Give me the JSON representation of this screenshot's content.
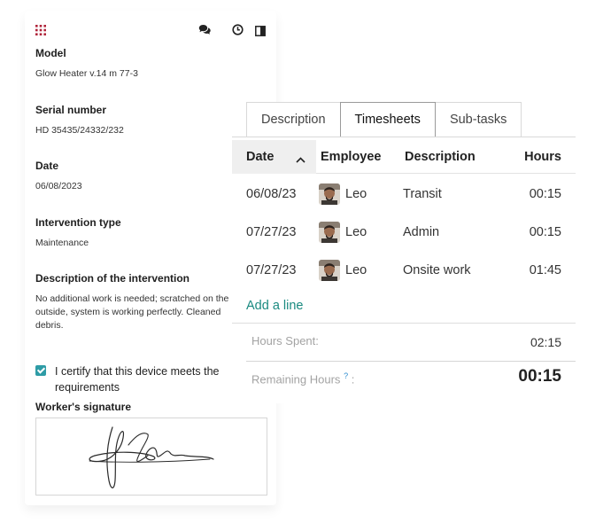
{
  "form": {
    "model_label": "Model",
    "model_value": "Glow Heater v.14 m 77-3",
    "serial_label": "Serial number",
    "serial_value": "HD 35435/24332/232",
    "date_label": "Date",
    "date_value": "06/08/2023",
    "type_label": "Intervention type",
    "type_value": "Maintenance",
    "desc_label": "Description of the intervention",
    "desc_line1": "No additional work is needed; scratched on the",
    "desc_line2": "outside, system is working perfectly. Cleaned",
    "desc_line3": "debris.",
    "certify_line1": "I certify that this device meets the",
    "certify_line2": "requirements",
    "certify_checked": true,
    "signature_label": "Worker's signature"
  },
  "icons": {
    "apps": "apps-grid-icon",
    "chat": "chat-icon",
    "activity": "clock-icon",
    "panel": "side-panel-icon"
  },
  "timesheet": {
    "tabs": [
      "Description",
      "Timesheets",
      "Sub-tasks"
    ],
    "active_tab": "Timesheets",
    "columns": [
      "Date",
      "Employee",
      "Description",
      "Hours"
    ],
    "rows": [
      {
        "date": "06/08/23",
        "employee": "Leo",
        "description": "Transit",
        "hours": "00:15"
      },
      {
        "date": "07/27/23",
        "employee": "Leo",
        "description": "Admin",
        "hours": "00:15"
      },
      {
        "date": "07/27/23",
        "employee": "Leo",
        "description": "Onsite work",
        "hours": "01:45"
      }
    ],
    "add_line": "Add a line",
    "hours_spent_label": "Hours Spent:",
    "hours_spent_value": "02:15",
    "remaining_label": "Remaining Hours",
    "remaining_hint": "?",
    "remaining_colon": ":",
    "remaining_value": "00:15"
  },
  "colors": {
    "accent_teal": "#1a8a80",
    "checkbox": "#2e9ca6",
    "apps_icon": "#b0243a"
  }
}
